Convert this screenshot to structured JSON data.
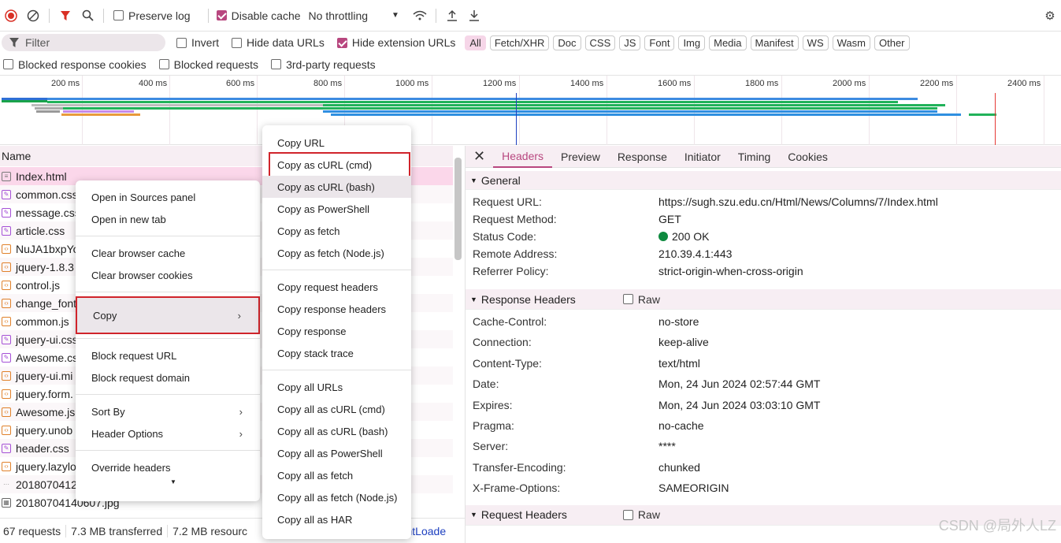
{
  "toolbar": {
    "preserve_log": "Preserve log",
    "disable_cache": "Disable cache",
    "throttling": "No throttling"
  },
  "filterbar": {
    "placeholder": "Filter",
    "invert": "Invert",
    "hide_data_urls": "Hide data URLs",
    "hide_ext_urls": "Hide extension URLs",
    "types": [
      "All",
      "Fetch/XHR",
      "Doc",
      "CSS",
      "JS",
      "Font",
      "Img",
      "Media",
      "Manifest",
      "WS",
      "Wasm",
      "Other"
    ]
  },
  "filterbar2": {
    "blocked_cookies": "Blocked response cookies",
    "blocked_requests": "Blocked requests",
    "third_party": "3rd-party requests"
  },
  "timeline": {
    "ticks": [
      "200 ms",
      "400 ms",
      "600 ms",
      "800 ms",
      "1000 ms",
      "1200 ms",
      "1400 ms",
      "1600 ms",
      "1800 ms",
      "2000 ms",
      "2200 ms",
      "2400 ms"
    ]
  },
  "list": {
    "header": "Name",
    "rows": [
      {
        "name": "Index.html",
        "type": "doc"
      },
      {
        "name": "common.css",
        "type": "css"
      },
      {
        "name": "message.css",
        "type": "css"
      },
      {
        "name": "article.css",
        "type": "css"
      },
      {
        "name": "NuJA1bxpYo",
        "type": "js"
      },
      {
        "name": "jquery-1.8.3",
        "type": "js"
      },
      {
        "name": "control.js",
        "type": "js"
      },
      {
        "name": "change_font",
        "type": "js"
      },
      {
        "name": "common.js",
        "type": "js"
      },
      {
        "name": "jquery-ui.css",
        "type": "css"
      },
      {
        "name": "Awesome.css",
        "type": "css"
      },
      {
        "name": "jquery-ui.mi",
        "type": "js"
      },
      {
        "name": "jquery.form.",
        "type": "js"
      },
      {
        "name": "Awesome.js",
        "type": "js"
      },
      {
        "name": "jquery.unob",
        "type": "js"
      },
      {
        "name": "header.css",
        "type": "css"
      },
      {
        "name": "jquery.lazylo",
        "type": "js"
      },
      {
        "name": "2018070412",
        "type": "other"
      },
      {
        "name": "20180704140607.jpg",
        "type": "img"
      }
    ]
  },
  "status": {
    "requests": "67 requests",
    "transferred": "7.3 MB transferred",
    "resources": "7.2 MB resourc",
    "dcl": "ntentLoade"
  },
  "context_menu": {
    "items": [
      "Open in Sources panel",
      "Open in new tab",
      "Clear browser cache",
      "Clear browser cookies",
      "Copy",
      "Block request URL",
      "Block request domain",
      "Sort By",
      "Header Options",
      "Override headers"
    ]
  },
  "copy_menu": {
    "group1": [
      "Copy URL",
      "Copy as cURL (cmd)",
      "Copy as cURL (bash)",
      "Copy as PowerShell",
      "Copy as fetch",
      "Copy as fetch (Node.js)"
    ],
    "group2": [
      "Copy request headers",
      "Copy response headers",
      "Copy response",
      "Copy stack trace"
    ],
    "group3": [
      "Copy all URLs",
      "Copy all as cURL (cmd)",
      "Copy all as cURL (bash)",
      "Copy all as PowerShell",
      "Copy all as fetch",
      "Copy all as fetch (Node.js)",
      "Copy all as HAR"
    ]
  },
  "detail": {
    "tabs": [
      "Headers",
      "Preview",
      "Response",
      "Initiator",
      "Timing",
      "Cookies"
    ],
    "general_title": "General",
    "general": [
      {
        "k": "Request URL:",
        "v": "https://sugh.szu.edu.cn/Html/News/Columns/7/Index.html"
      },
      {
        "k": "Request Method:",
        "v": "GET"
      },
      {
        "k": "Status Code:",
        "v": "200 OK"
      },
      {
        "k": "Remote Address:",
        "v": "210.39.4.1:443"
      },
      {
        "k": "Referrer Policy:",
        "v": "strict-origin-when-cross-origin"
      }
    ],
    "response_title": "Response Headers",
    "raw": "Raw",
    "response": [
      {
        "k": "Cache-Control:",
        "v": "no-store"
      },
      {
        "k": "Connection:",
        "v": "keep-alive"
      },
      {
        "k": "Content-Type:",
        "v": "text/html"
      },
      {
        "k": "Date:",
        "v": "Mon, 24 Jun 2024 02:57:44 GMT"
      },
      {
        "k": "Expires:",
        "v": "Mon, 24 Jun 2024 03:03:10 GMT"
      },
      {
        "k": "Pragma:",
        "v": "no-cache"
      },
      {
        "k": "Server:",
        "v": "****"
      },
      {
        "k": "Transfer-Encoding:",
        "v": "chunked"
      },
      {
        "k": "X-Frame-Options:",
        "v": "SAMEORIGIN"
      }
    ],
    "request_title": "Request Headers"
  },
  "watermark": "CSDN @局外人LZ"
}
